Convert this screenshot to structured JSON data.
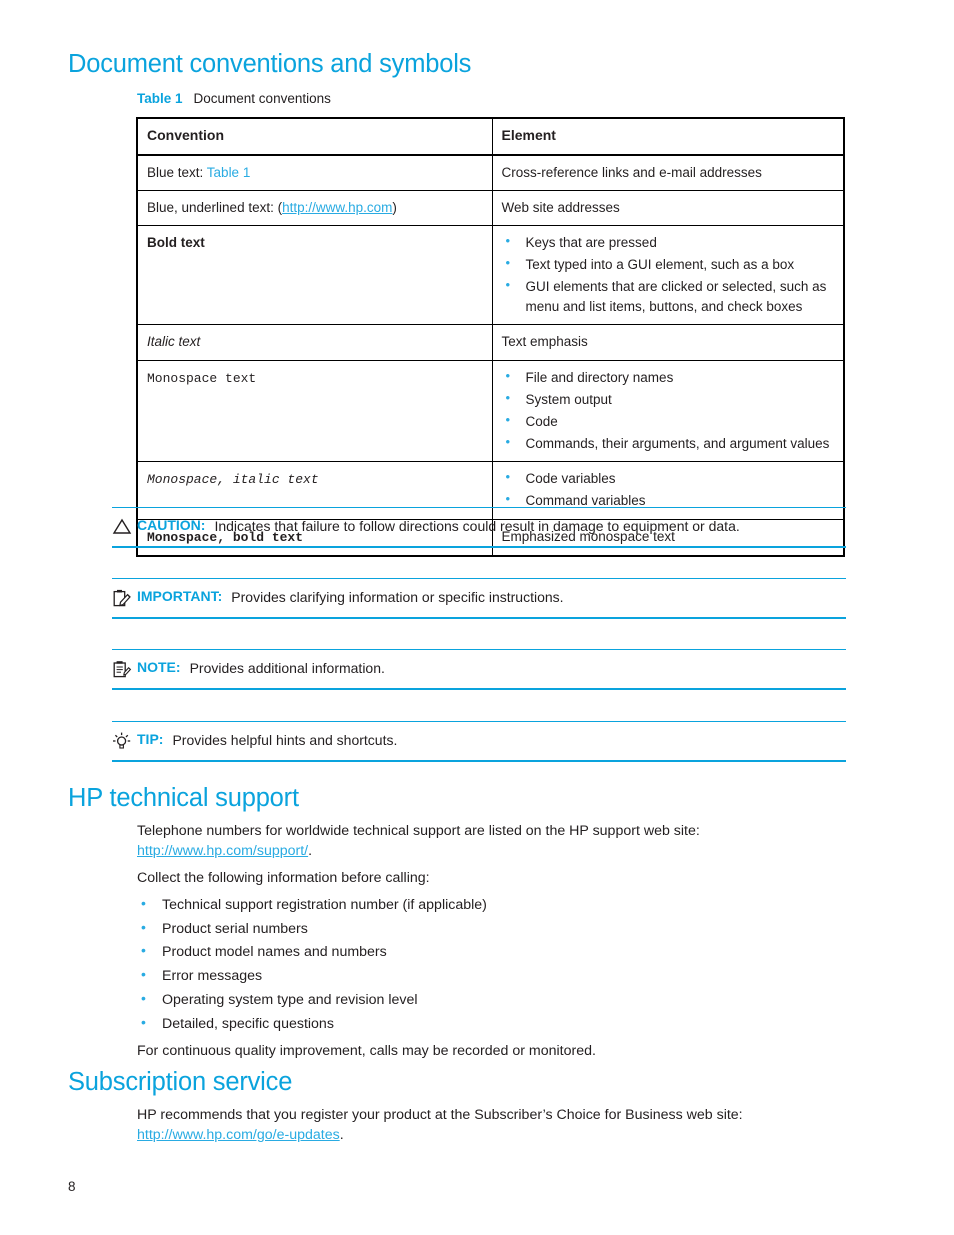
{
  "page": {
    "number": "8",
    "accent_color": "#0aa3dd",
    "link_color": "#29abe2",
    "text_color": "#231f20"
  },
  "sections": {
    "conventions_heading": "Document conventions and symbols",
    "support_heading": "HP technical support",
    "subscription_heading": "Subscription service"
  },
  "table": {
    "caption_label": "Table 1",
    "caption_text": "Document conventions",
    "headers": {
      "convention": "Convention",
      "element": "Element"
    },
    "rows": [
      {
        "convention_prefix": "Blue text: ",
        "convention_link": "Table 1",
        "element": "Cross-reference links and e-mail addresses"
      },
      {
        "convention_prefix": "Blue, underlined text: (",
        "convention_link": "http://www.hp.com",
        "convention_suffix": ")",
        "element": "Web site addresses"
      },
      {
        "convention": "Bold text",
        "element_list": [
          "Keys that are pressed",
          "Text typed into a GUI element, such as a box",
          "GUI elements that are clicked or selected, such as menu and list items, buttons, and check boxes"
        ]
      },
      {
        "convention": "Italic text",
        "element": "Text emphasis"
      },
      {
        "convention": "Monospace text",
        "element_list": [
          "File and directory names",
          "System output",
          "Code",
          "Commands, their arguments, and argument values"
        ]
      },
      {
        "convention": "Monospace, italic text",
        "element_list": [
          "Code variables",
          "Command variables"
        ]
      },
      {
        "convention": "Monospace, bold text",
        "element": "Emphasized monospace text"
      }
    ]
  },
  "notices": [
    {
      "icon": "caution-triangle-icon",
      "label": "CAUTION:",
      "text": "Indicates that failure to follow directions could result in damage to equipment or data."
    },
    {
      "icon": "important-clipboard-pencil-icon",
      "label": "IMPORTANT:",
      "text": "Provides clarifying information or specific instructions."
    },
    {
      "icon": "note-clipboard-icon",
      "label": "NOTE:",
      "text": "Provides additional information."
    },
    {
      "icon": "tip-lightbulb-icon",
      "label": "TIP:",
      "text": "Provides helpful hints and shortcuts."
    }
  ],
  "support": {
    "intro_text": "Telephone numbers for worldwide technical support are listed on the HP support web site:",
    "intro_link": "http://www.hp.com/support/",
    "intro_link_suffix": ".",
    "collect_text": "Collect the following information before calling:",
    "items": [
      "Technical support registration number (if applicable)",
      "Product serial numbers",
      "Product model names and numbers",
      "Error messages",
      "Operating system type and revision level",
      "Detailed, specific questions"
    ],
    "closing_text": "For continuous quality improvement, calls may be recorded or monitored."
  },
  "subscription": {
    "text": "HP recommends that you register your product at the Subscriber’s Choice for Business web site:",
    "link": "http://www.hp.com/go/e-updates",
    "link_suffix": "."
  }
}
